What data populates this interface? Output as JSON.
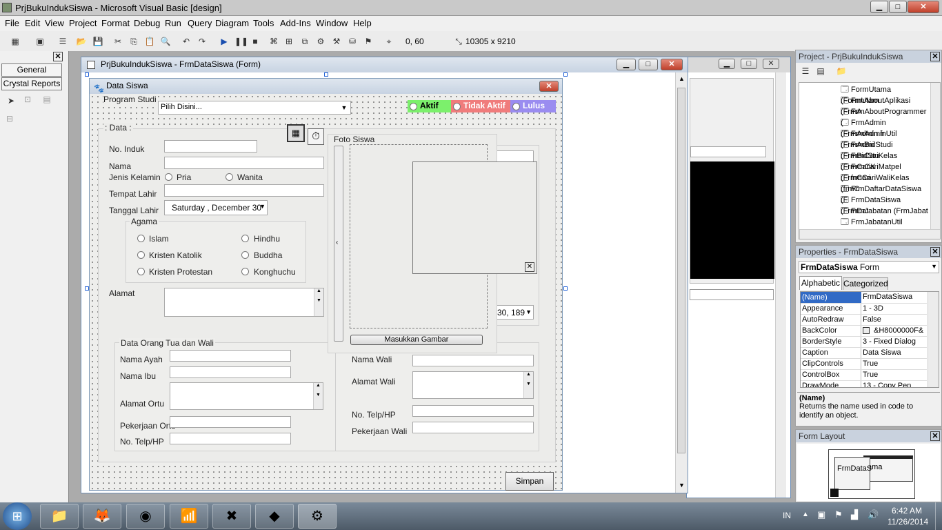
{
  "ide_title": "PrjBukuIndukSiswa - Microsoft Visual Basic [design]",
  "window_buttons": {
    "minimize": "▁",
    "maximize": "□",
    "close": "✕"
  },
  "menu": [
    "File",
    "Edit",
    "View",
    "Project",
    "Format",
    "Debug",
    "Run",
    "Query",
    "Diagram",
    "Tools",
    "Add-Ins",
    "Window",
    "Help"
  ],
  "toolbar": {
    "position": "0, 60",
    "size": "10305 x 9210"
  },
  "toolbox": {
    "tab_general": "General",
    "tab_crystal": "Crystal Reports"
  },
  "designer": {
    "title": "PrjBukuIndukSiswa - FrmDataSiswa (Form)"
  },
  "form": {
    "caption": "Data Siswa",
    "program_studi_label": "Program Studi",
    "program_studi_value": "Pilih Disini...",
    "status_aktif": "Aktif",
    "status_tidak_aktif": "Tidak Aktif",
    "status_lulus": "Lulus",
    "data_group": ": Data :",
    "no_induk": "No. Induk",
    "nama": "Nama",
    "jenis_kelamin": "Jenis Kelamin",
    "pria": "Pria",
    "wanita": "Wanita",
    "tempat_lahir": "Tempat Lahir",
    "tanggal_lahir": "Tanggal Lahir",
    "tanggal_value": "Saturday  , December 30",
    "agama_group": "Agama",
    "islam": "Islam",
    "hindhu": "Hindhu",
    "kristen_katolik": "Kristen Katolik",
    "buddha": "Buddha",
    "kristen_protestan": "Kristen Protestan",
    "konghuchu": "Konghuchu",
    "alamat": "Alamat",
    "ortu_group": "Data Orang Tua dan Wali",
    "nama_ayah": "Nama Ayah",
    "nama_ibu": "Nama Ibu",
    "alamat_ortu": "Alamat Ortu",
    "pekerjaan_ortu": "Pekerjaan Ortu",
    "no_telp_ortu": "No. Telp/HP",
    "nama_wali": "Nama Wali",
    "alamat_wali": "Alamat Wali",
    "no_telp_wali": "No. Telp/HP",
    "pekerjaan_wali": "Pekerjaan Wali",
    "foto_group": "Foto Siswa",
    "masukkan_gambar": "Masukkan Gambar",
    "date_fragment": "30, 189",
    "simpan": "Simpan"
  },
  "project_panel": {
    "title": "Project - PrjBukuIndukSiswa",
    "items": [
      "FormUtama (FormUtam",
      "FrmAboutAplikasi (FrmA",
      "FrmAboutProgrammer (",
      "FrmAdmin (FrmAdmin.fr",
      "FrmAdminUtil (FrmAdmi",
      "FrmBidStudi (FrmBidStu",
      "FrmCariKelas (FrmCariK",
      "FrmCariMatpel (FrmCari",
      "frmCariWaliKelas (frmC",
      "FrmDaftarDataSiswa (F",
      "FrmDataSiswa (FrmDat",
      "FrmJabatan (FrmJabat",
      "FrmJabatanUtil (FrmJab"
    ]
  },
  "properties_panel": {
    "title": "Properties - FrmDataSiswa",
    "object_name": "FrmDataSiswa",
    "object_type": "Form",
    "tab_alphabetic": "Alphabetic",
    "tab_categorized": "Categorized",
    "rows": [
      {
        "name": "(Name)",
        "value": "FrmDataSiswa"
      },
      {
        "name": "Appearance",
        "value": "1 - 3D"
      },
      {
        "name": "AutoRedraw",
        "value": "False"
      },
      {
        "name": "BackColor",
        "value": "&H8000000F&"
      },
      {
        "name": "BorderStyle",
        "value": "3 - Fixed Dialog"
      },
      {
        "name": "Caption",
        "value": "Data Siswa"
      },
      {
        "name": "ClipControls",
        "value": "True"
      },
      {
        "name": "ControlBox",
        "value": "True"
      },
      {
        "name": "DrawMode",
        "value": "13 - Copy Pen"
      }
    ],
    "desc_title": "(Name)",
    "desc_text": "Returns the name used in code to identify an object."
  },
  "form_layout": {
    "title": "Form Layout",
    "label1": "FrmDataS",
    "label2": "tama"
  },
  "taskbar": {
    "lang": "IN",
    "time": "6:42 AM",
    "date": "11/26/2014"
  },
  "colors": {
    "aktif": "#7cf06c",
    "tidak_aktif": "#f07c7c",
    "lulus": "#9a8cf0"
  }
}
